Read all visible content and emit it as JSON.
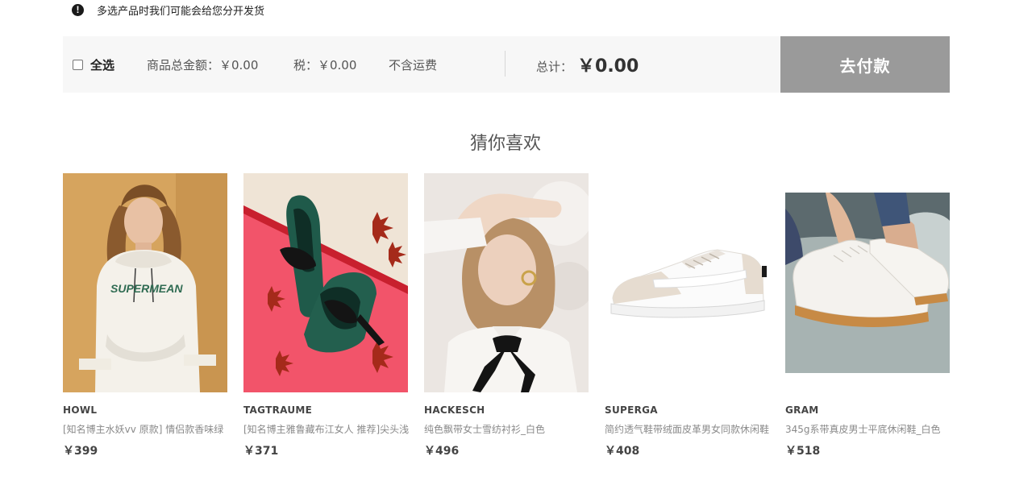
{
  "notice": {
    "icon": "exclamation-icon",
    "text": "多选产品时我们可能会给您分开发货"
  },
  "cart_bar": {
    "select_all_label": "全选",
    "select_all_checked": false,
    "goods_total": "商品总金额：￥0.00",
    "tax": "税：￥0.00",
    "shipping_note": "不含运费",
    "total_label": "总计：",
    "total_value": "￥0.00",
    "pay_button_label": "去付款",
    "pay_button_color": "#9a9a9a"
  },
  "recommend": {
    "title": "猜你喜欢",
    "products": [
      {
        "brand": "HOWL",
        "desc": "[知名博主水妖vv 原款] 情侣款香味绿",
        "price": "￥399",
        "image": "model-white-hoodie-supermean"
      },
      {
        "brand": "TAGTRAUME",
        "desc": "[知名博主雅鲁藏布江女人 推荐]尖头浅",
        "price": "￥371",
        "image": "green-velvet-bow-flats"
      },
      {
        "brand": "HACKESCH",
        "desc": "纯色飘带女士雪纺衬衫_白色",
        "price": "￥496",
        "image": "model-white-blouse-black-bow"
      },
      {
        "brand": "SUPERGA",
        "desc": "简约透气鞋带绒面皮革男女同款休闲鞋",
        "price": "￥408",
        "image": "white-beige-sneaker"
      },
      {
        "brand": "GRAM",
        "desc": "345g系带真皮男士平底休闲鞋_白色",
        "price": "￥518",
        "image": "white-leather-sneakers-worn"
      }
    ]
  }
}
